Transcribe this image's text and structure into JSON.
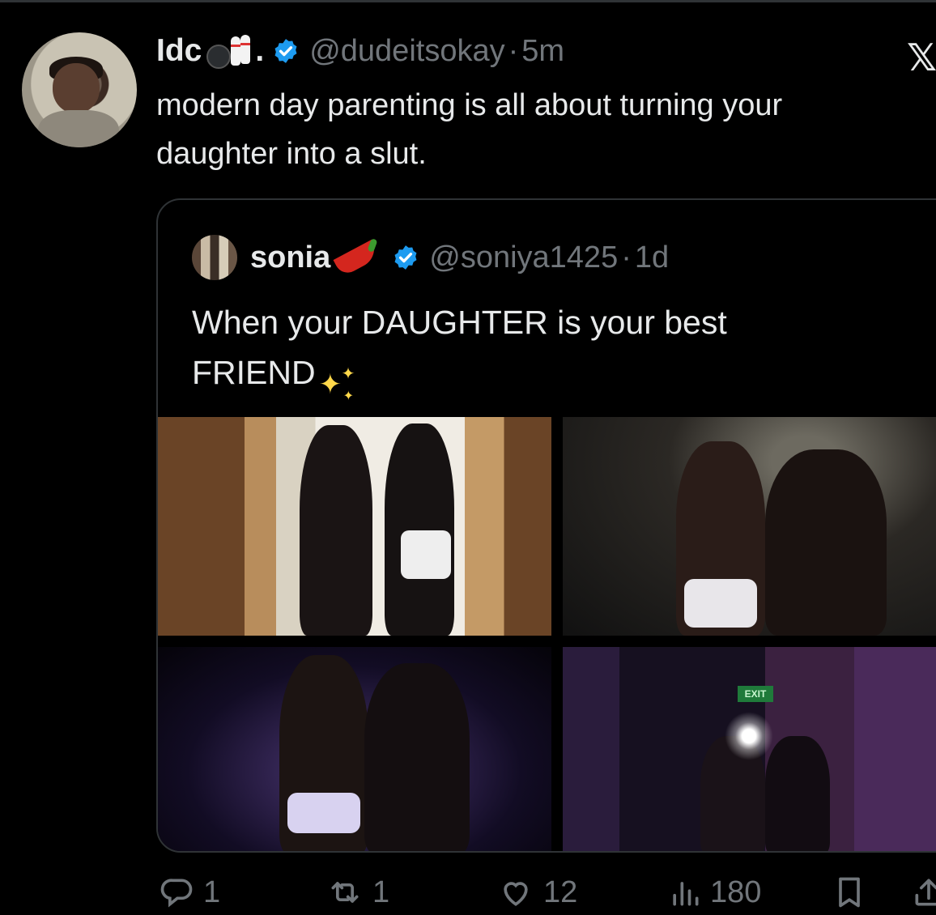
{
  "tweet": {
    "author": {
      "display_name": "Idc",
      "display_name_suffix": ".",
      "name_emoji": "bowling-emoji",
      "verified": true,
      "handle": "@dudeitsokay",
      "separator": "·",
      "time": "5m"
    },
    "text": "modern day parenting is all about turning your\ndaughter into a slut.",
    "platform_icon": "x-logo-icon"
  },
  "quoted_tweet": {
    "author": {
      "display_name": "sonia",
      "name_emoji": "hot-pepper-emoji",
      "verified": true,
      "handle": "@soniya1425",
      "separator": "·",
      "time": "1d"
    },
    "text": "When your DAUGHTER is your best\nFRIEND",
    "text_emoji": "sparkles-emoji",
    "photos": [
      {
        "name": "photo-mirror-selfie",
        "exit_sign": ""
      },
      {
        "name": "photo-car-selfie",
        "exit_sign": ""
      },
      {
        "name": "photo-club-selfie",
        "exit_sign": ""
      },
      {
        "name": "photo-club-entrance",
        "exit_sign": "EXIT"
      }
    ]
  },
  "actions": {
    "replies": "1",
    "reposts": "1",
    "likes": "12",
    "views": "180"
  },
  "colors": {
    "background": "#000000",
    "text_primary": "#e7e9ea",
    "text_secondary": "#71767b",
    "verified_blue": "#1d9bf0",
    "border": "#2f3336"
  }
}
